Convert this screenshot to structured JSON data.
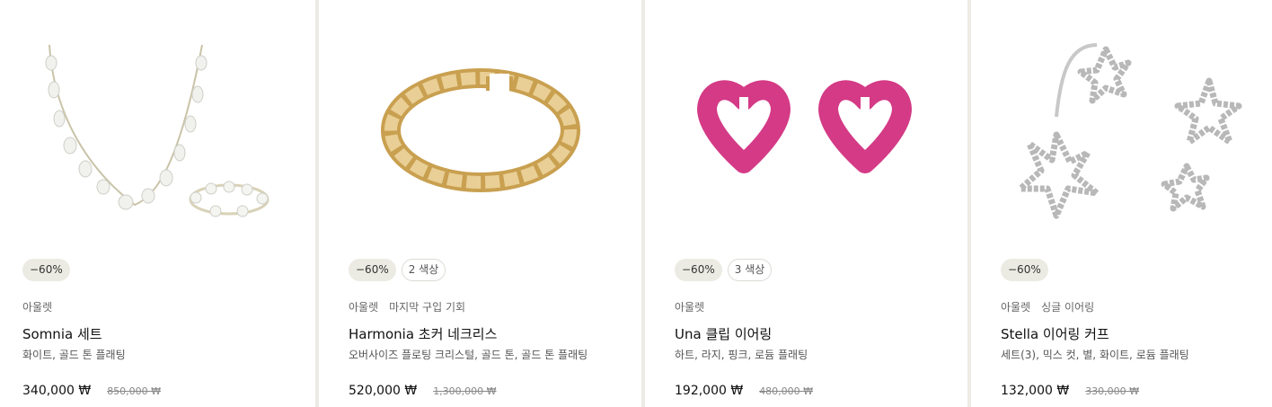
{
  "products": [
    {
      "discount": "−60%",
      "colors": "",
      "category": "아울렛",
      "tag": "",
      "name": "Somnia 세트",
      "desc": "화이트, 골드 톤 플래팅",
      "price": "340,000 ₩",
      "was": "850,000 ₩",
      "image": "necklace-ring-set"
    },
    {
      "discount": "−60%",
      "colors": "2 색상",
      "category": "아울렛",
      "tag": "마지막 구입 기회",
      "name": "Harmonia 초커 네크리스",
      "desc": "오버사이즈 플로팅 크리스털, 골드 톤, 골드 톤 플래팅",
      "price": "520,000 ₩",
      "was": "1,300,000 ₩",
      "image": "gold-choker"
    },
    {
      "discount": "−60%",
      "colors": "3 색상",
      "category": "아울렛",
      "tag": "",
      "name": "Una 클립 이어링",
      "desc": "하트, 라지, 핑크, 로듐 플래팅",
      "price": "192,000 ₩",
      "was": "480,000 ₩",
      "image": "pink-heart-earrings"
    },
    {
      "discount": "−60%",
      "colors": "",
      "category": "아울렛",
      "tag": "싱글 이어링",
      "name": "Stella 이어링 커프",
      "desc": "세트(3), 믹스 컷, 별, 화이트, 로듐 플래팅",
      "price": "132,000 ₩",
      "was": "330,000 ₩",
      "image": "star-ear-cuffs"
    }
  ],
  "colors": {
    "background": "#ecebe6",
    "card": "#ffffff",
    "discount_pill": "#ecebe3",
    "pink": "#d43a86",
    "gold": "#d9b26a"
  }
}
